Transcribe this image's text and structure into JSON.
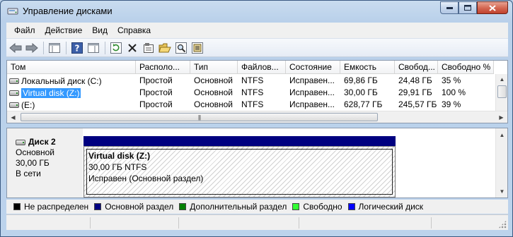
{
  "window": {
    "title": "Управление дисками"
  },
  "menu": [
    "Файл",
    "Действие",
    "Вид",
    "Справка"
  ],
  "volume_table": {
    "columns": [
      "Том",
      "Располо...",
      "Тип",
      "Файлов...",
      "Состояние",
      "Емкость",
      "Свобод...",
      "Свободно %"
    ],
    "rows": [
      [
        "Локальный диск (C:)",
        "Простой",
        "Основной",
        "NTFS",
        "Исправен...",
        "69,86 ГБ",
        "24,48 ГБ",
        "35 %"
      ],
      [
        "Virtual disk (Z:)",
        "Простой",
        "Основной",
        "NTFS",
        "Исправен...",
        "30,00 ГБ",
        "29,91 ГБ",
        "100 %"
      ],
      [
        "(E:)",
        "Простой",
        "Основной",
        "NTFS",
        "Исправен...",
        "628,77 ГБ",
        "245,57 ГБ",
        "39 %"
      ]
    ],
    "selected_row": 1
  },
  "disk": {
    "name": "Диск 2",
    "kind": "Основной",
    "size": "30,00 ГБ",
    "status": "В сети",
    "partition": {
      "name": "Virtual disk  (Z:)",
      "size_fs": "30,00 ГБ NTFS",
      "state": "Исправен (Основной раздел)"
    }
  },
  "legend": [
    {
      "label": "Не распределен",
      "color": "#000000"
    },
    {
      "label": "Основной раздел",
      "color": "#000080"
    },
    {
      "label": "Дополнительный раздел",
      "color": "#008000"
    },
    {
      "label": "Свободно",
      "color": "#33ff33"
    },
    {
      "label": "Логический диск",
      "color": "#0000ff"
    }
  ],
  "toolbar_icons": [
    "back-icon",
    "forward-icon",
    "console-tree-icon",
    "help-icon",
    "properties-pane-icon",
    "refresh-icon",
    "delete-icon",
    "properties-icon",
    "open-icon",
    "search-icon",
    "settings-icon"
  ]
}
